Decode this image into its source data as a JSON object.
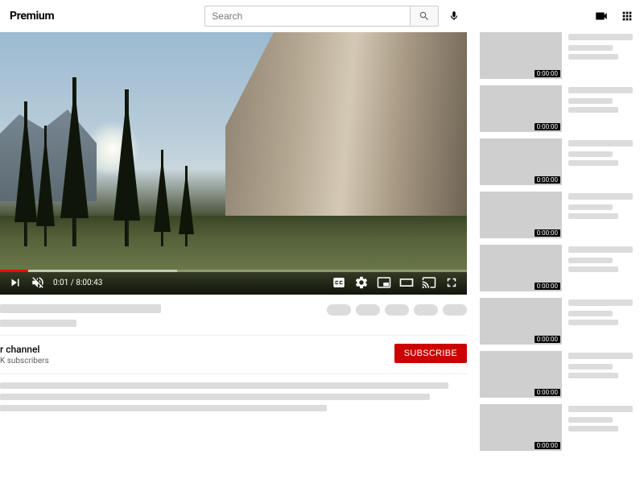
{
  "header": {
    "brand": "Premium",
    "search_placeholder": "Search"
  },
  "player": {
    "elapsed": "0:01",
    "duration": "8:00:43",
    "time_sep": " / "
  },
  "channel": {
    "name": "r channel",
    "subs": "K subscribers",
    "subscribe_label": "SUBSCRIBE"
  },
  "sidebar": {
    "items": [
      {
        "duration": "0:00:00"
      },
      {
        "duration": "0:00:00"
      },
      {
        "duration": "0:00:00"
      },
      {
        "duration": "0:00:00"
      },
      {
        "duration": "0:00:00"
      },
      {
        "duration": "0:00:00"
      },
      {
        "duration": "0:00:00"
      },
      {
        "duration": "0:00:00"
      }
    ]
  }
}
